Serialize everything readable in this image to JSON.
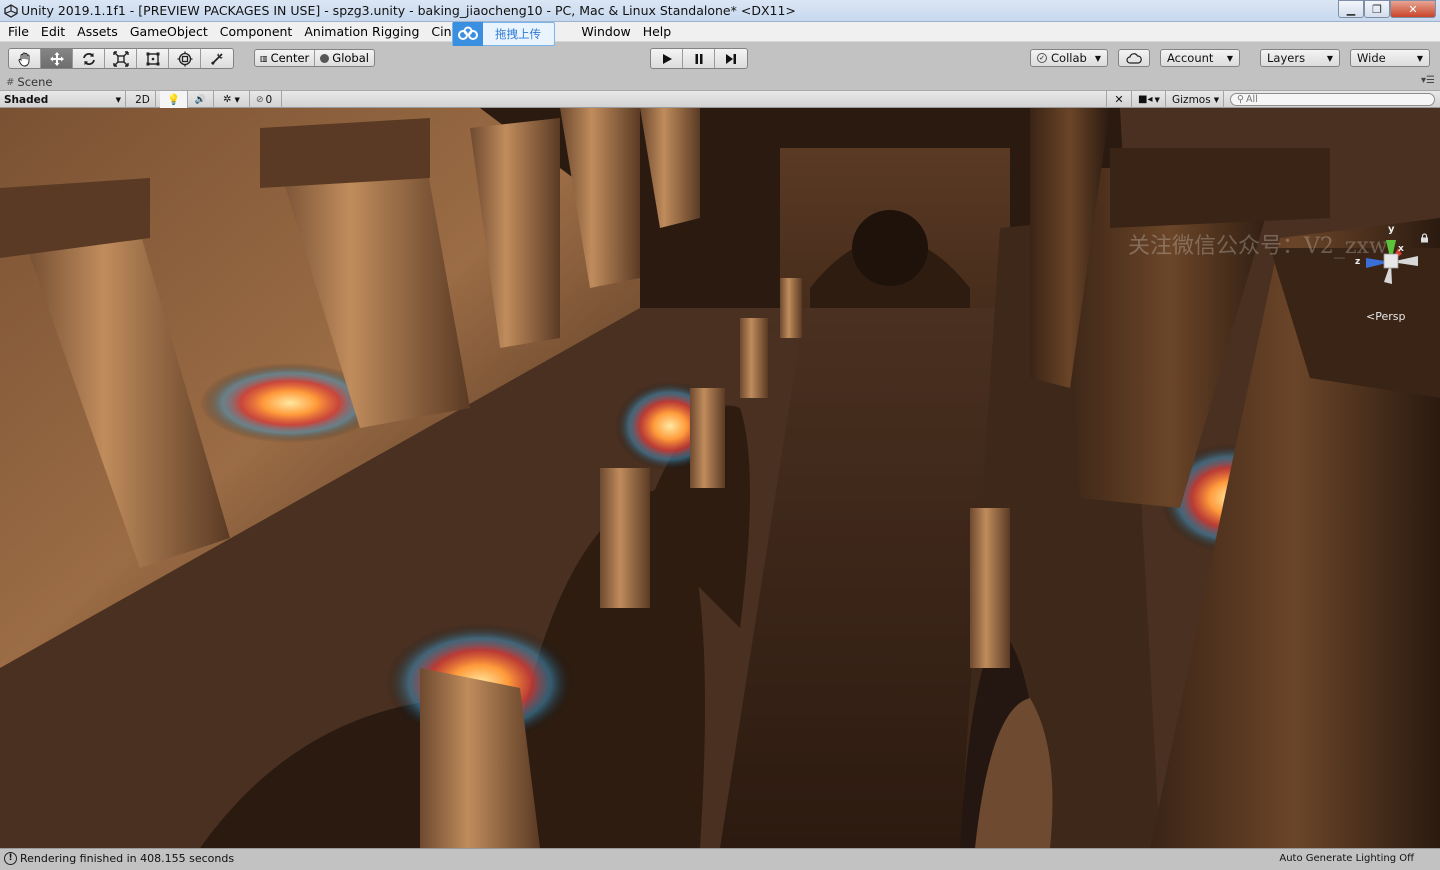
{
  "window": {
    "title": "Unity 2019.1.1f1 - [PREVIEW PACKAGES IN USE] - spzg3.unity - baking_jiaocheng10 - PC, Mac & Linux Standalone* <DX11>",
    "minimize_glyph": "▁",
    "maximize_glyph": "❐",
    "close_glyph": "✕"
  },
  "menu": {
    "items": [
      "File",
      "Edit",
      "Assets",
      "GameObject",
      "Component",
      "Animation Rigging",
      "Cinem",
      "Window",
      "Help"
    ]
  },
  "upload_widget": {
    "label": "拖拽上传",
    "icon": "cloud-share-icon"
  },
  "toolbar": {
    "tools": [
      {
        "name": "hand-tool",
        "icon": "hand-icon",
        "active": false
      },
      {
        "name": "move-tool",
        "icon": "move-icon",
        "active": true
      },
      {
        "name": "rotate-tool",
        "icon": "rotate-icon",
        "active": false
      },
      {
        "name": "scale-tool",
        "icon": "scale-icon",
        "active": false
      },
      {
        "name": "rect-tool",
        "icon": "rect-icon",
        "active": false
      },
      {
        "name": "transform-tool",
        "icon": "transform-icon",
        "active": false
      },
      {
        "name": "custom-tool",
        "icon": "custom-tools-icon",
        "active": false
      }
    ],
    "pivot_label": "Center",
    "space_label": "Global",
    "collab_label": "Collab",
    "account_label": "Account",
    "layers_label": "Layers",
    "layout_label": "Wide"
  },
  "scene_tab": {
    "label": "Scene"
  },
  "scene_toolbar": {
    "shading_mode": "Shaded",
    "mode_2d": "2D",
    "hidden_count": "0",
    "gizmos_label": "Gizmos",
    "search_placeholder": "All"
  },
  "scene_view": {
    "watermark": "关注微信公众号：V2_zxw",
    "projection": "Persp",
    "axis_y": "y",
    "axis_x": "x",
    "axis_z": "z"
  },
  "status": {
    "message": "Rendering finished in 408.155 seconds",
    "lighting": "Auto Generate Lighting Off"
  },
  "colors": {
    "editor_bg": "#c2c2c2",
    "scene_shadow": "#2a1a10",
    "stone_lit": "#b9875a",
    "gizmo_y": "#5bc33b",
    "gizmo_x": "#d43d2a",
    "gizmo_z": "#3a6fd8"
  }
}
